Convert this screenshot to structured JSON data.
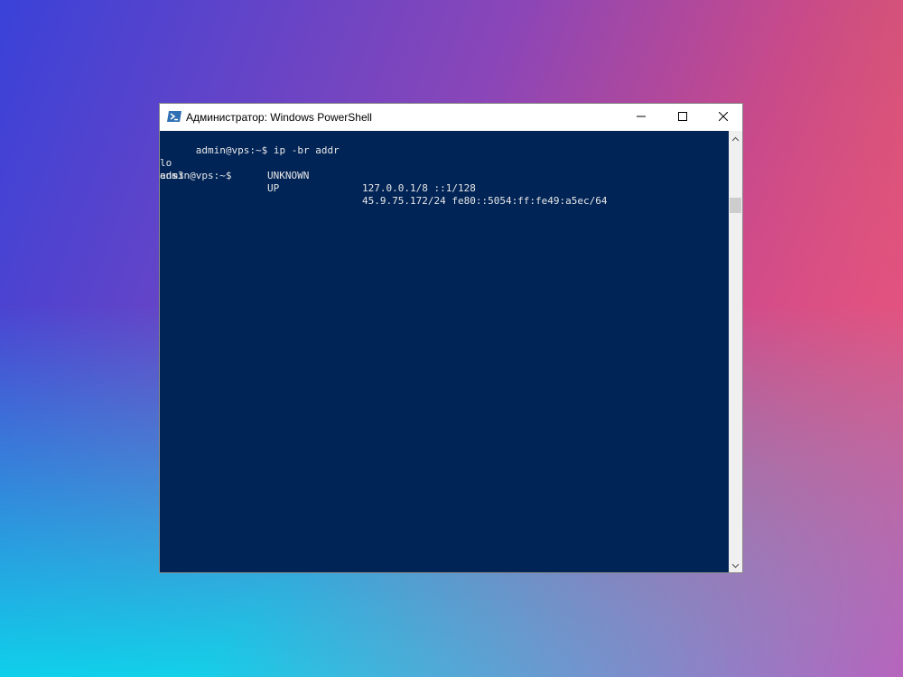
{
  "window": {
    "title": "Администратор: Windows PowerShell"
  },
  "terminal": {
    "prompt": "admin@vps:~$",
    "command": "ip -br addr",
    "rows": [
      {
        "iface": "lo",
        "state": "UNKNOWN",
        "addrs": "127.0.0.1/8 ::1/128"
      },
      {
        "iface": "ens3",
        "state": "UP",
        "addrs": "45.9.75.172/24 fe80::5054:ff:fe49:a5ec/64"
      }
    ],
    "final_prompt": "admin@vps:~$"
  },
  "colors": {
    "terminal_bg": "#012456",
    "terminal_fg": "#e8e8e8"
  },
  "icons": {
    "app": "powershell-icon",
    "minimize": "minimize-icon",
    "maximize": "maximize-icon",
    "close": "close-icon",
    "scroll_up": "chevron-up-icon",
    "scroll_down": "chevron-down-icon"
  }
}
